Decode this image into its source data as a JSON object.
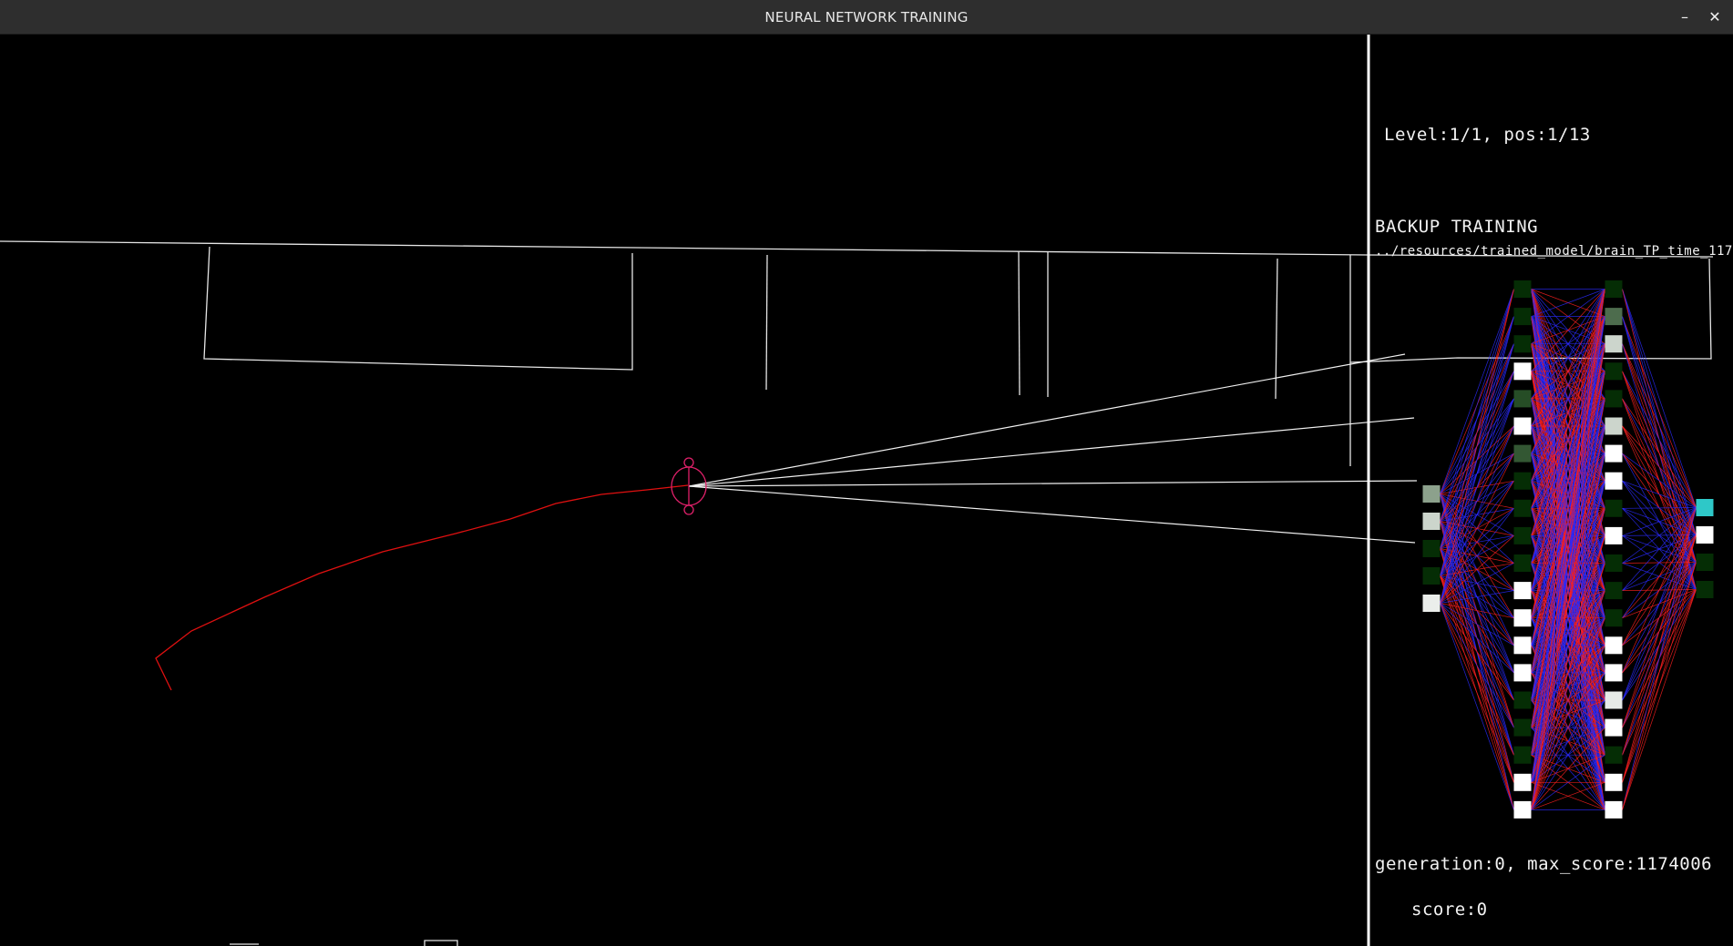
{
  "window": {
    "title": "NEURAL NETWORK TRAINING",
    "minimize_glyph": "–",
    "close_glyph": "✕"
  },
  "hud": {
    "level_text": "Level:1/1, pos:1/13",
    "mode_text": "BACKUP TRAINING",
    "model_path": "../resources/trained_model/brain_TP_time_117",
    "generation_text": "generation:0, max_score:1174006",
    "score_text": "score:0"
  },
  "colors": {
    "background": "#000000",
    "track": "#e6e6e6",
    "trail": "#e01010",
    "agent": "#e0206a",
    "sensor": "#f0f0f0",
    "weight_positive": "#ff2020",
    "weight_negative": "#2a2aff",
    "output_active": "#2ec8c8"
  },
  "network": {
    "input_levels": [
      0.55,
      0.8,
      0.05,
      0.05,
      0.92
    ],
    "hidden1_levels": [
      0.05,
      0.05,
      0.05,
      1,
      0.15,
      1,
      0.2,
      0.05,
      0.05,
      0.05,
      0.05,
      1,
      1,
      1,
      1,
      0.05,
      0.05,
      0.05,
      1,
      1
    ],
    "hidden2_levels": [
      0.05,
      0.3,
      0.8,
      0.05,
      0.05,
      0.8,
      1,
      1,
      0.05,
      1,
      0.05,
      0.05,
      0.05,
      1,
      1,
      0.9,
      1,
      0.05,
      1,
      1
    ],
    "output_levels": [
      1,
      1,
      0.05,
      0.05
    ],
    "active_output_index": 0
  }
}
